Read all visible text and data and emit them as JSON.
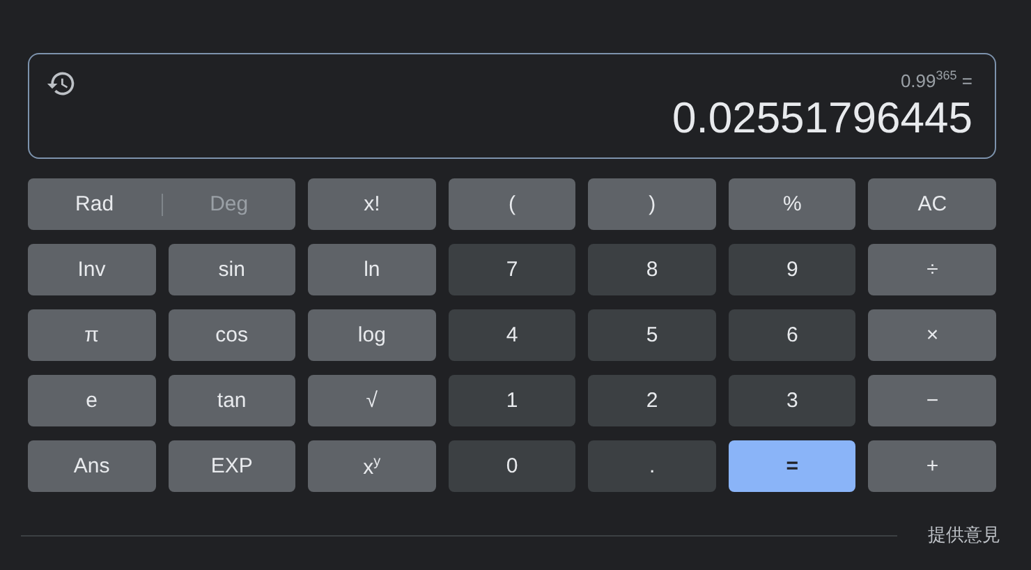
{
  "display": {
    "expression": "0.99$^{365}$ =",
    "result": "0.02551796445"
  },
  "angle_toggle": [
    {
      "label": "Rad",
      "selected": true
    },
    {
      "label": "Deg",
      "selected": false
    }
  ],
  "keys": [
    {
      "label": "x!",
      "kind": "function"
    },
    {
      "label": "(",
      "kind": "function"
    },
    {
      "label": ")",
      "kind": "function"
    },
    {
      "label": "%",
      "kind": "function"
    },
    {
      "label": "AC",
      "kind": "function"
    },
    {
      "label": "Inv",
      "kind": "function"
    },
    {
      "label": "sin",
      "kind": "function"
    },
    {
      "label": "ln",
      "kind": "function"
    },
    {
      "label": "7",
      "kind": "digit"
    },
    {
      "label": "8",
      "kind": "digit"
    },
    {
      "label": "9",
      "kind": "digit"
    },
    {
      "label": "÷",
      "kind": "function"
    },
    {
      "label": "π",
      "kind": "function"
    },
    {
      "label": "cos",
      "kind": "function"
    },
    {
      "label": "log",
      "kind": "function"
    },
    {
      "label": "4",
      "kind": "digit"
    },
    {
      "label": "5",
      "kind": "digit"
    },
    {
      "label": "6",
      "kind": "digit"
    },
    {
      "label": "×",
      "kind": "function"
    },
    {
      "label": "e",
      "kind": "function"
    },
    {
      "label": "tan",
      "kind": "function"
    },
    {
      "label": "√",
      "kind": "function"
    },
    {
      "label": "1",
      "kind": "digit"
    },
    {
      "label": "2",
      "kind": "digit"
    },
    {
      "label": "3",
      "kind": "digit"
    },
    {
      "label": "−",
      "kind": "function"
    },
    {
      "label": "Ans",
      "kind": "function"
    },
    {
      "label": "EXP",
      "kind": "function"
    },
    {
      "label": "x$^{y}$",
      "kind": "function"
    },
    {
      "label": "0",
      "kind": "digit"
    },
    {
      "label": ".",
      "kind": "digit"
    },
    {
      "label": "=",
      "kind": "equals"
    },
    {
      "label": "+",
      "kind": "function"
    }
  ],
  "feedback_link": "提供意見"
}
